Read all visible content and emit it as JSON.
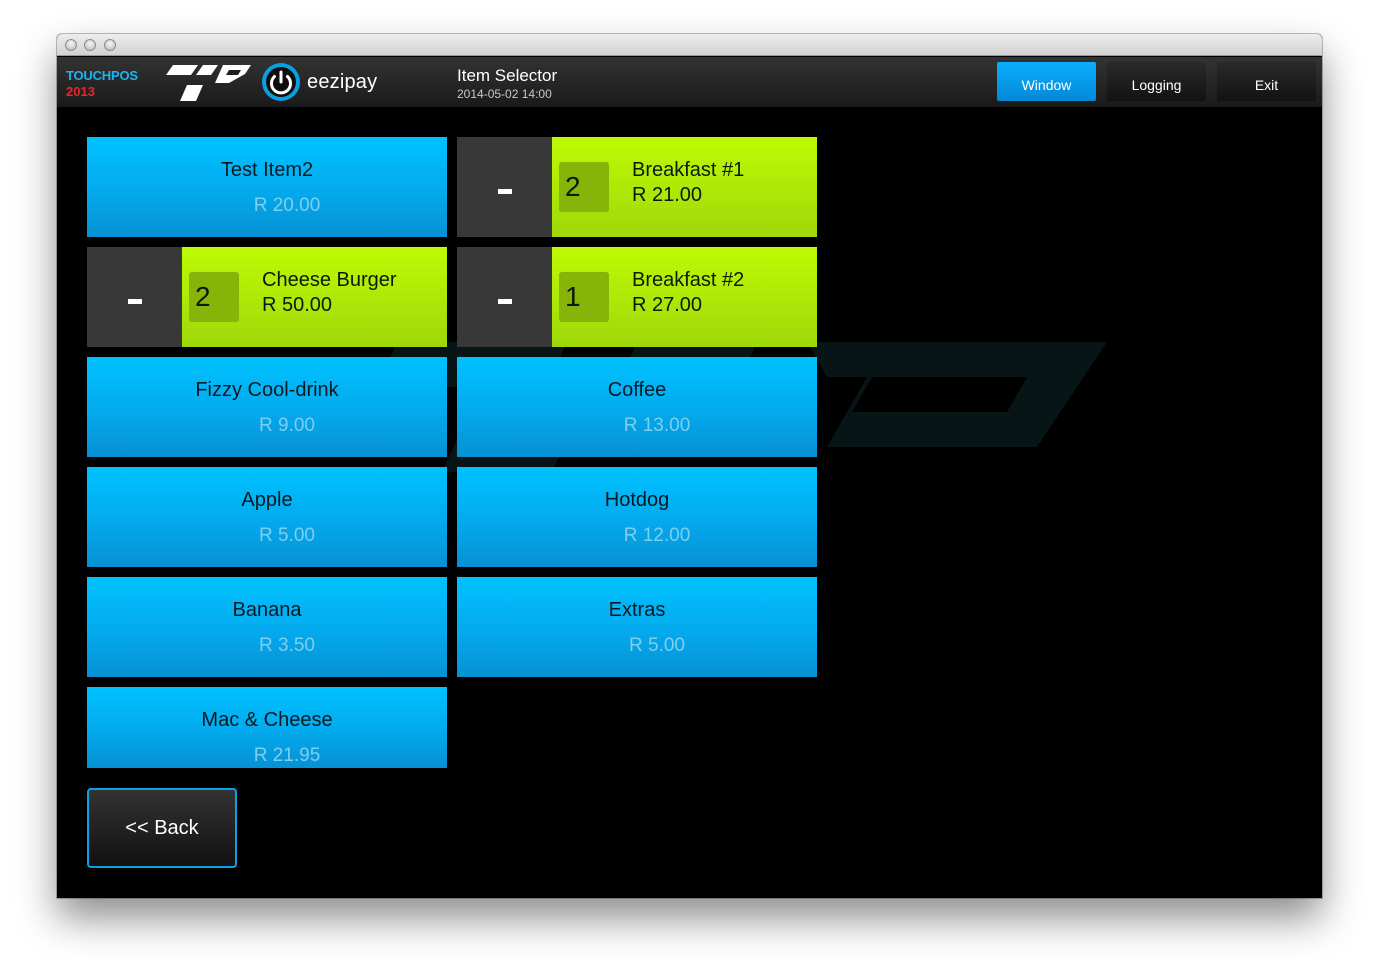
{
  "brand": {
    "name": "TOUCHPOS",
    "year": "2013",
    "partner": "eezipay"
  },
  "header": {
    "title": "Item Selector",
    "datetime": "2014-05-02 14:00",
    "buttons": {
      "window": "Window",
      "logging": "Logging",
      "exit": "Exit"
    }
  },
  "selected": [
    {
      "minus": "-",
      "qty": "2",
      "name": "Breakfast #1",
      "price": "R 21.00"
    },
    {
      "minus": "-",
      "qty": "2",
      "name": "Cheese Burger",
      "price": "R 50.00"
    },
    {
      "minus": "-",
      "qty": "1",
      "name": "Breakfast #2",
      "price": "R 27.00"
    }
  ],
  "items": [
    {
      "name": "Test Item2",
      "price": "R 20.00"
    },
    {
      "name": "Fizzy Cool-drink",
      "price": "R 9.00"
    },
    {
      "name": "Coffee",
      "price": "R 13.00"
    },
    {
      "name": "Apple",
      "price": "R 5.00"
    },
    {
      "name": "Hotdog",
      "price": "R 12.00"
    },
    {
      "name": "Banana",
      "price": "R 3.50"
    },
    {
      "name": "Extras",
      "price": "R 5.00"
    },
    {
      "name": "Mac & Cheese",
      "price": "R 21.95"
    }
  ],
  "back_label": "<< Back",
  "colors": {
    "accent": "#0aaeff",
    "item_tile": "#03acef",
    "selected_tile": "#b4f005",
    "brand_blue": "#18b6f0",
    "brand_red": "#e8262a"
  }
}
